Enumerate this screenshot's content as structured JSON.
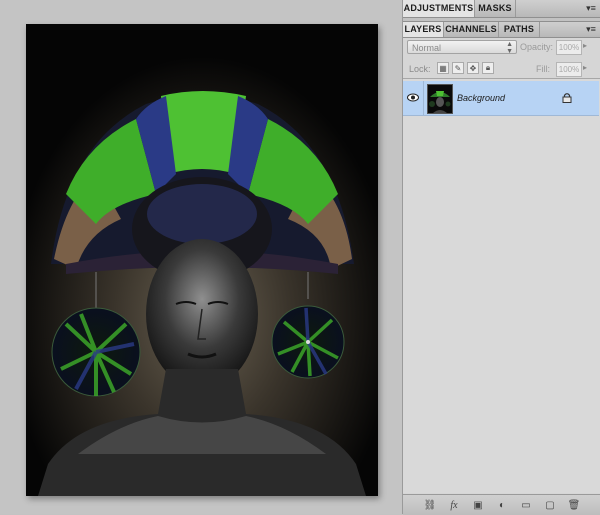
{
  "panels": {
    "adjustments_tabs": [
      {
        "label": "ADJUSTMENTS",
        "active": true
      },
      {
        "label": "MASKS",
        "active": false
      }
    ],
    "layers_tabs": [
      {
        "label": "LAYERS",
        "active": true
      },
      {
        "label": "CHANNELS",
        "active": false
      },
      {
        "label": "PATHS",
        "active": false
      }
    ],
    "menu_icon": "panel-menu-icon"
  },
  "layers_panel": {
    "blend_mode": "Normal",
    "opacity_label": "Opacity:",
    "opacity_value": "100%",
    "lock_label": "Lock:",
    "fill_label": "Fill:",
    "fill_value": "100%",
    "layers": [
      {
        "name": "Background",
        "visible": true,
        "locked": true,
        "selected": true
      }
    ],
    "footer_icons": [
      "link-icon",
      "fx-icon",
      "mask-icon",
      "adjustment-layer-icon",
      "group-folder-icon",
      "new-layer-icon",
      "trash-icon"
    ],
    "footer_glyphs": [
      "⛓",
      "fx",
      "▣",
      "◐",
      "▭",
      "▢",
      "🗑"
    ]
  },
  "colors": {
    "selected_layer": "#b7d3f4",
    "panel_bg": "#d6d6d6",
    "canvas_bg": "#c4c4c4"
  }
}
